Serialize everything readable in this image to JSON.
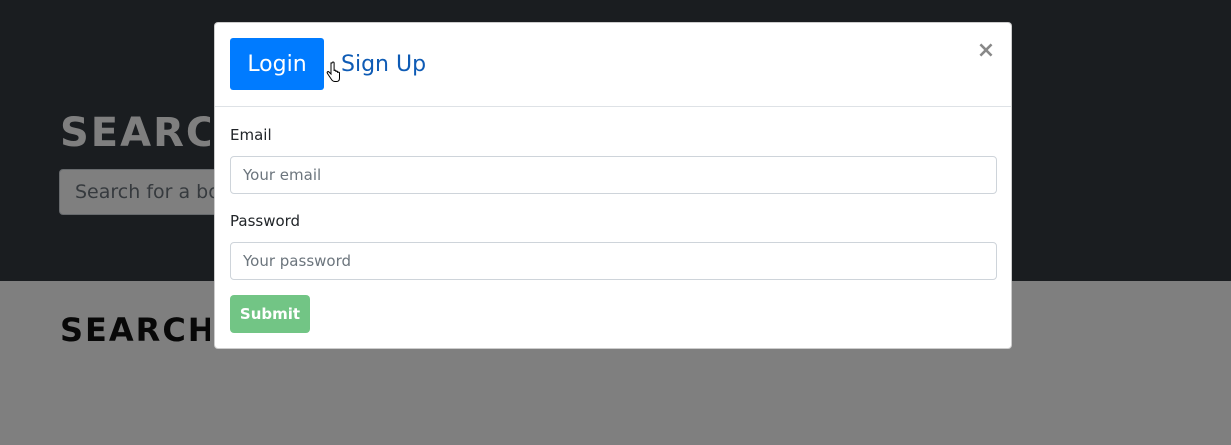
{
  "hero": {
    "title": "SEARCH",
    "search_placeholder": "Search for a book"
  },
  "results": {
    "title": "SEARCH"
  },
  "modal": {
    "tabs": {
      "login_label": "Login",
      "signup_label": "Sign Up"
    },
    "close_label": "×",
    "email_label": "Email",
    "email_placeholder": "Your email",
    "password_label": "Password",
    "password_placeholder": "Your password",
    "submit_label": "Submit"
  },
  "colors": {
    "primary": "#007bff",
    "success": "#28a745",
    "hero_bg": "#343a40"
  }
}
